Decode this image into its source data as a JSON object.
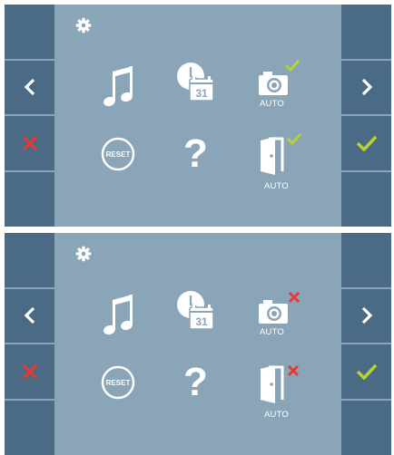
{
  "screens": [
    {
      "id": "top",
      "camera_auto_label": "AUTO",
      "door_auto_label": "AUTO",
      "camera_auto_state": "enabled",
      "door_auto_state": "enabled",
      "reset_label": "RESET",
      "help_glyph": "?"
    },
    {
      "id": "bottom",
      "camera_auto_label": "AUTO",
      "door_auto_label": "AUTO",
      "camera_auto_state": "disabled",
      "door_auto_state": "disabled",
      "reset_label": "RESET",
      "help_glyph": "?"
    }
  ],
  "colors": {
    "panel": "#8aa5b8",
    "side_button": "#4a6a86",
    "icon": "#ffffff",
    "check": "#b5d334",
    "cross": "#e53a32"
  },
  "icons": {
    "settings": "gear-icon",
    "prev": "chevron-left-icon",
    "next": "chevron-right-icon",
    "cancel": "cross-icon",
    "confirm": "checkmark-icon",
    "melody": "music-note-icon",
    "date_time": "clock-calendar-icon",
    "calendar_day": "31",
    "camera": "camera-icon",
    "door": "door-icon",
    "reset": "reset-icon",
    "help": "question-mark-icon"
  }
}
